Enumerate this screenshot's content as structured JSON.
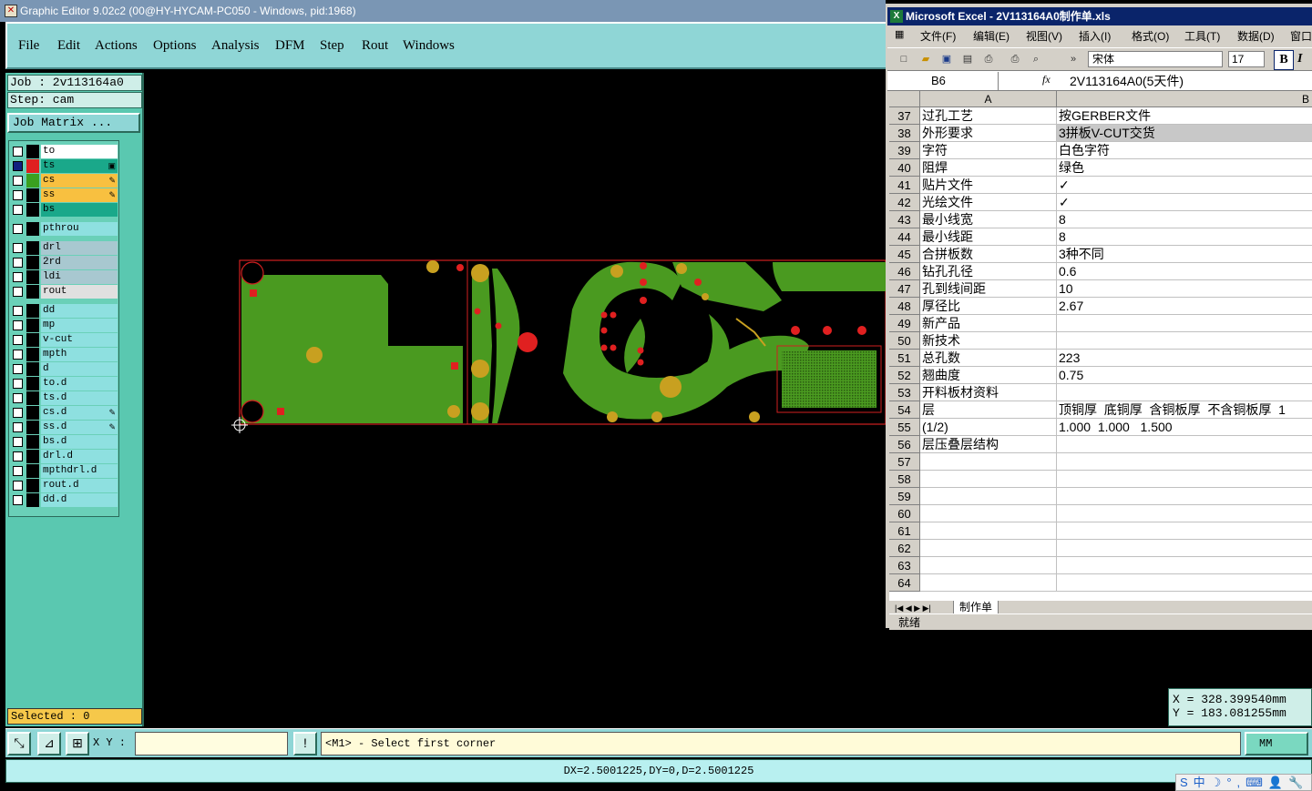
{
  "editor": {
    "title": "Graphic Editor 9.02c2 (00@HY-HYCAM-PC050 - Windows, pid:1968)",
    "menu": [
      "File",
      "Edit",
      "Actions",
      "Options",
      "Analysis",
      "DFM",
      "Step",
      "Rout",
      "Windows"
    ],
    "job_label": "Job : 2v113164a0",
    "step_label": "Step: cam",
    "job_matrix_label": "Job Matrix ...",
    "layers": [
      {
        "name": "to",
        "color": "#ffffff",
        "swatch": "#000000",
        "checked": false,
        "mark": ""
      },
      {
        "name": "ts",
        "color": "#1aa88a",
        "swatch": "#e02020",
        "checked": true,
        "mark": "▣"
      },
      {
        "name": "cs",
        "color": "#f8c040",
        "swatch": "#3aa020",
        "checked": false,
        "mark": "✎"
      },
      {
        "name": "ss",
        "color": "#f8c040",
        "swatch": "#000000",
        "checked": false,
        "mark": "✎"
      },
      {
        "name": "bs",
        "color": "#1aa88a",
        "swatch": "#000000",
        "checked": false,
        "mark": ""
      },
      {
        "name": "pthrou",
        "color": "#8ee0e0",
        "swatch": "#000000",
        "checked": false,
        "mark": ""
      },
      {
        "name": "drl",
        "color": "#a8c8d0",
        "swatch": "#000000",
        "checked": false,
        "mark": ""
      },
      {
        "name": "2rd",
        "color": "#a8c8d0",
        "swatch": "#000000",
        "checked": false,
        "mark": ""
      },
      {
        "name": "ldi",
        "color": "#a8c8d0",
        "swatch": "#000000",
        "checked": false,
        "mark": ""
      },
      {
        "name": "rout",
        "color": "#e0e0e0",
        "swatch": "#000000",
        "checked": false,
        "mark": ""
      },
      {
        "name": "dd",
        "color": "#8ee0e0",
        "swatch": "#000000",
        "checked": false,
        "mark": ""
      },
      {
        "name": "mp",
        "color": "#8ee0e0",
        "swatch": "#000000",
        "checked": false,
        "mark": ""
      },
      {
        "name": "v-cut",
        "color": "#8ee0e0",
        "swatch": "#000000",
        "checked": false,
        "mark": ""
      },
      {
        "name": "mpth",
        "color": "#8ee0e0",
        "swatch": "#000000",
        "checked": false,
        "mark": ""
      },
      {
        "name": "d",
        "color": "#8ee0e0",
        "swatch": "#000000",
        "checked": false,
        "mark": ""
      },
      {
        "name": "to.d",
        "color": "#8ee0e0",
        "swatch": "#000000",
        "checked": false,
        "mark": ""
      },
      {
        "name": "ts.d",
        "color": "#8ee0e0",
        "swatch": "#000000",
        "checked": false,
        "mark": ""
      },
      {
        "name": "cs.d",
        "color": "#8ee0e0",
        "swatch": "#000000",
        "checked": false,
        "mark": "✎"
      },
      {
        "name": "ss.d",
        "color": "#8ee0e0",
        "swatch": "#000000",
        "checked": false,
        "mark": "✎"
      },
      {
        "name": "bs.d",
        "color": "#8ee0e0",
        "swatch": "#000000",
        "checked": false,
        "mark": ""
      },
      {
        "name": "drl.d",
        "color": "#8ee0e0",
        "swatch": "#000000",
        "checked": false,
        "mark": ""
      },
      {
        "name": "mpthdrl.d",
        "color": "#8ee0e0",
        "swatch": "#000000",
        "checked": false,
        "mark": ""
      },
      {
        "name": "rout.d",
        "color": "#8ee0e0",
        "swatch": "#000000",
        "checked": false,
        "mark": ""
      },
      {
        "name": "dd.d",
        "color": "#8ee0e0",
        "swatch": "#000000",
        "checked": false,
        "mark": ""
      }
    ],
    "selected_label": "Selected : 0",
    "xy_label": "X Y :",
    "xy_value": "",
    "prompt": "<M1> - Select first corner",
    "units": "MM",
    "status": "DX=2.5001225,DY=0,D=2.5001225",
    "coord_x": "X  =  328.399540mm",
    "coord_y": "Y  =  183.081255mm",
    "ime_tray": "S中☽°,⌨👤🔧"
  },
  "excel": {
    "title": "Microsoft Excel - 2V113164A0制作单.xls",
    "menu": [
      "文件(F)",
      "编辑(E)",
      "视图(V)",
      "插入(I)",
      "格式(O)",
      "工具(T)",
      "数据(D)",
      "窗口"
    ],
    "font": "宋体",
    "size": "17",
    "cell_ref": "B6",
    "formula": "2V113164A0(5天件)",
    "col_a": "A",
    "col_b": "B",
    "rows": [
      {
        "n": "37",
        "a": "过孔工艺",
        "b": "按GERBER文件"
      },
      {
        "n": "38",
        "a": "外形要求",
        "b": "3拼板V-CUT交货",
        "hl": true
      },
      {
        "n": "39",
        "a": "字符",
        "b": "白色字符"
      },
      {
        "n": "40",
        "a": "阻焊",
        "b": "绿色"
      },
      {
        "n": "41",
        "a": "贴片文件",
        "b": "✓"
      },
      {
        "n": "42",
        "a": "光绘文件",
        "b": "✓"
      },
      {
        "n": "43",
        "a": "最小线宽",
        "b": "8"
      },
      {
        "n": "44",
        "a": "最小线距",
        "b": "8"
      },
      {
        "n": "45",
        "a": "合拼板数",
        "b": "3种不同"
      },
      {
        "n": "46",
        "a": "钻孔孔径",
        "b": "0.6"
      },
      {
        "n": "47",
        "a": "孔到线间距",
        "b": "10"
      },
      {
        "n": "48",
        "a": "厚径比",
        "b": "2.67"
      },
      {
        "n": "49",
        "a": "新产品",
        "b": ""
      },
      {
        "n": "50",
        "a": "新技术",
        "b": ""
      },
      {
        "n": "51",
        "a": "总孔数",
        "b": "223"
      },
      {
        "n": "52",
        "a": "翘曲度",
        "b": "0.75"
      },
      {
        "n": "53",
        "a": "开料板材资料",
        "b": ""
      },
      {
        "n": "54",
        "a": "层",
        "b": "顶铜厚  底铜厚  含铜板厚  不含铜板厚  1"
      },
      {
        "n": "55",
        "a": "(1/2)",
        "b": "1.000  1.000   1.500"
      },
      {
        "n": "56",
        "a": "层压叠层结构",
        "b": ""
      },
      {
        "n": "57",
        "a": "",
        "b": ""
      },
      {
        "n": "58",
        "a": "",
        "b": ""
      },
      {
        "n": "59",
        "a": "",
        "b": ""
      },
      {
        "n": "60",
        "a": "",
        "b": ""
      },
      {
        "n": "61",
        "a": "",
        "b": ""
      },
      {
        "n": "62",
        "a": "",
        "b": ""
      },
      {
        "n": "63",
        "a": "",
        "b": ""
      },
      {
        "n": "64",
        "a": "",
        "b": ""
      }
    ],
    "sheet_tab": "制作单",
    "sheet_nav": "|◀ ◀ ▶ ▶|",
    "status": "就绪"
  }
}
